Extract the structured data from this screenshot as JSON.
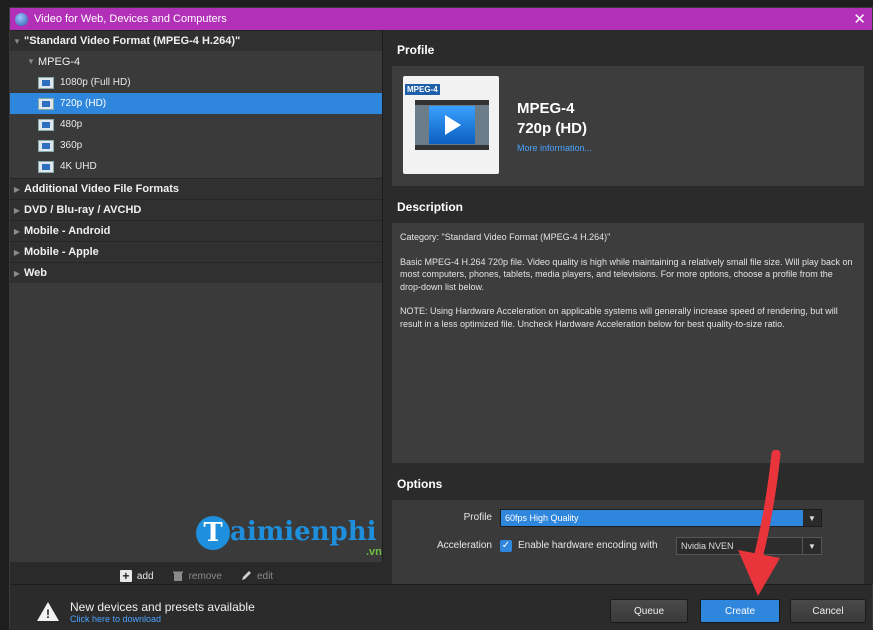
{
  "window": {
    "title": "Video for Web, Devices and Computers"
  },
  "tree": {
    "expanded_category": "\"Standard Video Format (MPEG-4 H.264)\"",
    "subgroup": "MPEG-4",
    "presets": [
      "1080p (Full HD)",
      "720p (HD)",
      "480p",
      "360p",
      "4K UHD"
    ],
    "selected_preset": "720p (HD)",
    "collapsed_categories": [
      "Additional Video File Formats",
      "DVD / Blu-ray / AVCHD",
      "Mobile - Android",
      "Mobile - Apple",
      "Web"
    ]
  },
  "left_toolbar": {
    "add_label": "add",
    "remove_label": "remove",
    "edit_label": "edit"
  },
  "watermark": {
    "logo_letter": "T",
    "text": "aimienphi",
    "suffix": ".vn"
  },
  "profile": {
    "header": "Profile",
    "thumb_tag": "MPEG-4",
    "name": "MPEG-4",
    "resolution": "720p (HD)",
    "more_link": "More information..."
  },
  "description": {
    "header": "Description",
    "category_line": "Category: \"Standard Video Format (MPEG-4 H.264)\"",
    "body": "Basic MPEG-4 H.264 720p file. Video quality is high while maintaining a relatively small file size. Will play back on most computers, phones, tablets, media players, and televisions. For more options, choose a profile from the drop-down list below.",
    "note": "NOTE: Using Hardware Acceleration on applicable systems will generally increase speed of rendering, but will result in a less optimized file. Uncheck Hardware Acceleration below for best quality-to-size ratio."
  },
  "options": {
    "header": "Options",
    "profile_label": "Profile",
    "profile_value": "60fps High Quality",
    "acceleration_label": "Acceleration",
    "hw_checkbox_label": "Enable hardware encoding with",
    "hw_checked": true,
    "hw_value": "Nvidia NVEN"
  },
  "notice": {
    "title": "New devices and presets available",
    "link": "Click here to download"
  },
  "buttons": {
    "queue": "Queue",
    "create": "Create",
    "cancel": "Cancel"
  },
  "colors": {
    "titlebar": "#b22fb8",
    "accent": "#2f86dd",
    "annotation_arrow": "#e8343a"
  },
  "icons": [
    "app-globe-icon",
    "close-icon",
    "video-file-icon",
    "plus-icon",
    "trash-icon",
    "pencil-icon",
    "warning-icon",
    "checkmark-icon",
    "chevron-down-icon"
  ]
}
